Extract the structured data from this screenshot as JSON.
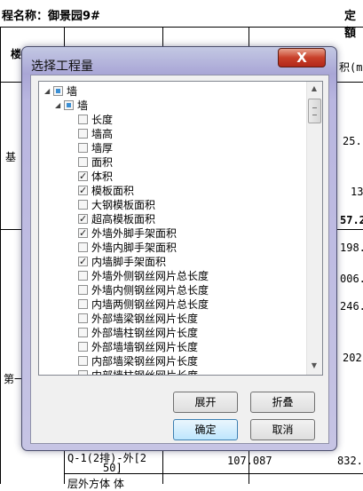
{
  "background": {
    "header_left": "程名称：御景园9#",
    "header_right": "定額",
    "left_col": [
      "楼",
      "基",
      "第一"
    ],
    "right_col": [
      "积(m",
      "25.",
      "13",
      "57.2",
      "198.",
      "006.",
      "246.",
      "202",
      "832."
    ],
    "bottom_row": {
      "name_line1": "Q-1(2排)-外[2",
      "name_line2": "50]",
      "value": "107.087",
      "name_line3": "层外方体 体"
    }
  },
  "dialog": {
    "title": "选择工程量",
    "close_label": "X",
    "tree": [
      {
        "label": "墙",
        "level": 0,
        "state": "partial",
        "expanded": true
      },
      {
        "label": "墙",
        "level": 1,
        "state": "partial",
        "expanded": true
      },
      {
        "label": "长度",
        "level": 2,
        "state": "unchecked"
      },
      {
        "label": "墙高",
        "level": 2,
        "state": "unchecked"
      },
      {
        "label": "墙厚",
        "level": 2,
        "state": "unchecked"
      },
      {
        "label": "面积",
        "level": 2,
        "state": "unchecked"
      },
      {
        "label": "体积",
        "level": 2,
        "state": "checked"
      },
      {
        "label": "模板面积",
        "level": 2,
        "state": "checked"
      },
      {
        "label": "大钢模板面积",
        "level": 2,
        "state": "unchecked"
      },
      {
        "label": "超高模板面积",
        "level": 2,
        "state": "checked"
      },
      {
        "label": "外墙外脚手架面积",
        "level": 2,
        "state": "checked"
      },
      {
        "label": "外墙内脚手架面积",
        "level": 2,
        "state": "unchecked"
      },
      {
        "label": "内墙脚手架面积",
        "level": 2,
        "state": "checked"
      },
      {
        "label": "外墙外侧钢丝网片总长度",
        "level": 2,
        "state": "unchecked"
      },
      {
        "label": "外墙内侧钢丝网片总长度",
        "level": 2,
        "state": "unchecked"
      },
      {
        "label": "内墙两侧钢丝网片总长度",
        "level": 2,
        "state": "unchecked"
      },
      {
        "label": "外部墙梁钢丝网片长度",
        "level": 2,
        "state": "unchecked"
      },
      {
        "label": "外部墙柱钢丝网片长度",
        "level": 2,
        "state": "unchecked"
      },
      {
        "label": "外部墙墙钢丝网片长度",
        "level": 2,
        "state": "unchecked"
      },
      {
        "label": "内部墙梁钢丝网片长度",
        "level": 2,
        "state": "unchecked"
      },
      {
        "label": "内部墙柱钢丝网片长度",
        "level": 2,
        "state": "unchecked"
      }
    ],
    "buttons": {
      "expand": "展开",
      "collapse": "折叠",
      "ok": "确定",
      "cancel": "取消"
    }
  }
}
